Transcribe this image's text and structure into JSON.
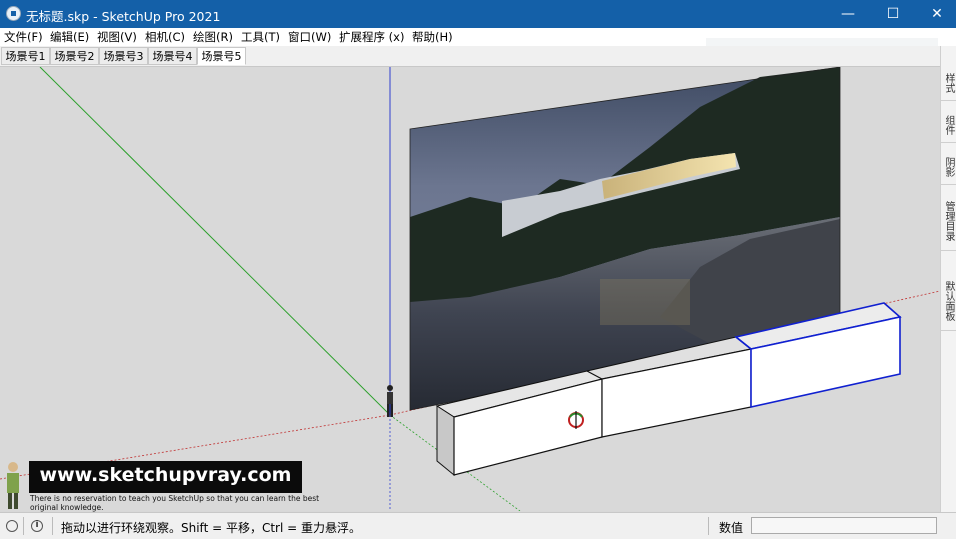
{
  "window": {
    "title": "无标题.skp - SketchUp Pro 2021",
    "minimize": "—",
    "maximize": "☐",
    "close": "✕"
  },
  "menu": [
    "文件(F)",
    "编辑(E)",
    "视图(V)",
    "相机(C)",
    "绘图(R)",
    "工具(T)",
    "窗口(W)",
    "扩展程序 (x)",
    "帮助(H)"
  ],
  "scene_tabs": [
    "场景号1",
    "场景号2",
    "场景号3",
    "场景号4",
    "场景号5"
  ],
  "active_scene_index": 4,
  "right_panel_tabs": [
    "样式",
    "组件",
    "阴影",
    "管理目录",
    "默认面板"
  ],
  "watermark": {
    "url": "www.sketchupvray.com",
    "note": "There is no reservation to teach you SketchUp so that you can learn the best original knowledge."
  },
  "status": {
    "text": "拖动以进行环绕观察。Shift = 平移，Ctrl = 重力悬浮。",
    "measurements_label": "数值",
    "measurements_value": ""
  },
  "colors": {
    "titlebar": "#1460a8",
    "viewport_bg": "#d9d9d9",
    "axis_green": "#2ca02c",
    "axis_blue": "#3040d0",
    "axis_red": "#c03030",
    "selection_blue": "#1020d0"
  },
  "icons": [
    "app-icon",
    "orbit-cursor-icon",
    "geolocation-icon",
    "info-icon"
  ]
}
